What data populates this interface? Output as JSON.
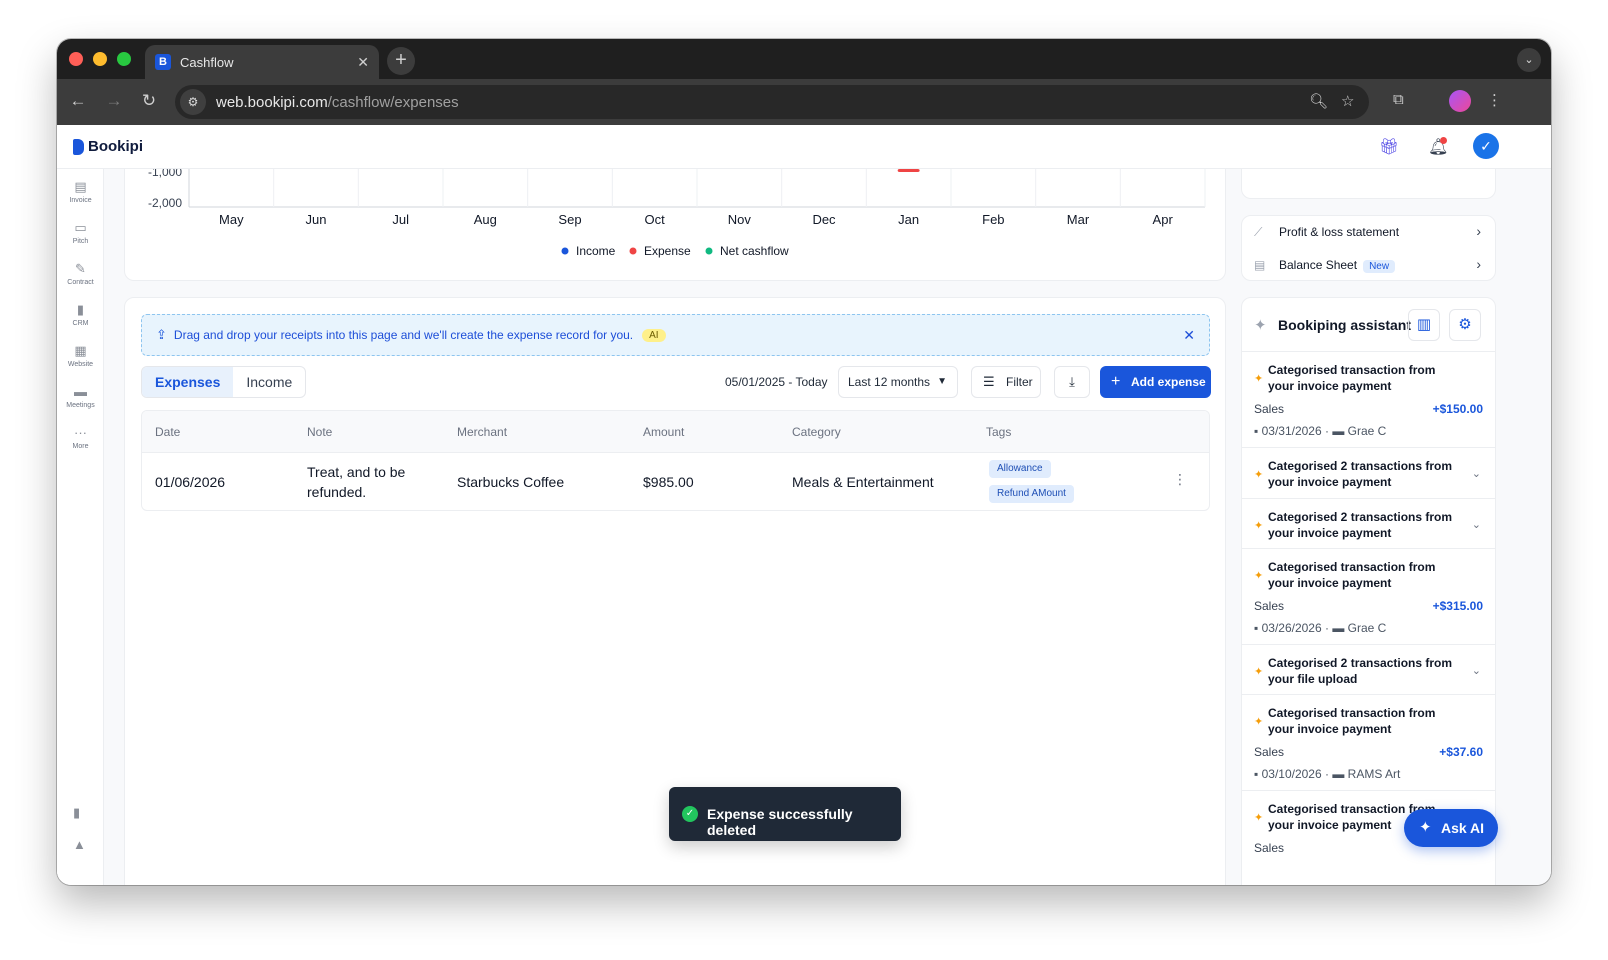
{
  "browser": {
    "tab_title": "Cashflow",
    "favicon_letter": "B",
    "url_host": "web.bookipi.com",
    "url_path": "/cashflow/expenses"
  },
  "app": {
    "logo": "Bookipi"
  },
  "sidebar": {
    "items": [
      {
        "label": "Invoice",
        "icon": "invoice-icon"
      },
      {
        "label": "Pitch",
        "icon": "pitch-icon"
      },
      {
        "label": "Contract",
        "icon": "contract-icon"
      },
      {
        "label": "CRM",
        "icon": "crm-icon"
      },
      {
        "label": "Website",
        "icon": "website-icon"
      },
      {
        "label": "Meetings",
        "icon": "meetings-icon"
      },
      {
        "label": "More",
        "icon": "more-icon"
      }
    ]
  },
  "chart_data": {
    "type": "bar",
    "categories": [
      "May",
      "Jun",
      "Jul",
      "Aug",
      "Sep",
      "Oct",
      "Nov",
      "Dec",
      "Jan",
      "Feb",
      "Mar",
      "Apr"
    ],
    "y_ticks": [
      "-1,000",
      "-2,000"
    ],
    "series": [
      {
        "name": "Income",
        "color": "#1a56db"
      },
      {
        "name": "Expense",
        "color": "#ef4444"
      },
      {
        "name": "Net cashflow",
        "color": "#10b981"
      }
    ],
    "legend_position": "bottom-center"
  },
  "dropzone": {
    "text": "Drag and drop your receipts into this page and we'll create the expense record for you.",
    "badge": "AI"
  },
  "tabs": [
    "Expenses",
    "Income"
  ],
  "controls": {
    "date_range": "05/01/2025 - Today",
    "period": "Last 12 months",
    "filter": "Filter",
    "add_expense": "Add expense"
  },
  "table": {
    "columns": [
      "Date",
      "Note",
      "Merchant",
      "Amount",
      "Category",
      "Tags"
    ],
    "rows": [
      {
        "date": "01/06/2026",
        "note_line1": "Treat, and to be",
        "note_line2": "refunded.",
        "merchant": "Starbucks Coffee",
        "amount": "$985.00",
        "category": "Meals & Entertainment",
        "tags": [
          "Allowance",
          "Refund AMount"
        ]
      }
    ]
  },
  "reports": {
    "pl": "Profit & loss statement",
    "bs": "Balance Sheet",
    "bs_badge": "New"
  },
  "assistant": {
    "title": "Bookiping assistant",
    "feed": [
      {
        "title": "Categorised transaction from your invoice payment",
        "category": "Sales",
        "amount": "+$150.00",
        "date": "03/31/2026",
        "client": "Grae C"
      },
      {
        "title": "Categorised 2 transactions from your invoice payment"
      },
      {
        "title": "Categorised 2 transactions from your invoice payment"
      },
      {
        "title": "Categorised transaction from your invoice payment",
        "category": "Sales",
        "amount": "+$315.00",
        "date": "03/26/2026",
        "client": "Grae C"
      },
      {
        "title": "Categorised 2 transactions from your file upload"
      },
      {
        "title": "Categorised transaction from your invoice payment",
        "category": "Sales",
        "amount": "+$37.60",
        "date": "03/10/2026",
        "client": "RAMS Art"
      },
      {
        "title": "Categorised transaction from your invoice payment",
        "category": "Sales"
      }
    ]
  },
  "toast": {
    "message": "Expense successfully deleted"
  },
  "ask_ai": "Ask AI"
}
